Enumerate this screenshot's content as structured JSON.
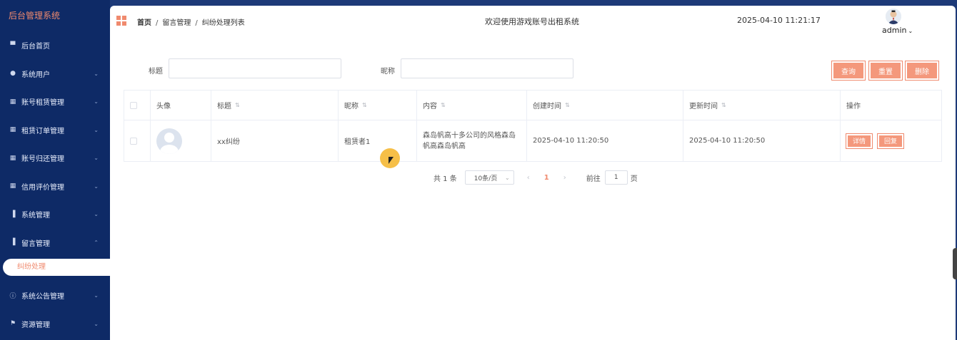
{
  "sidebar": {
    "brand": "后台管理系统",
    "items": [
      {
        "label": "后台首页",
        "icon": "monitor-icon"
      },
      {
        "label": "系统用户",
        "icon": "user-icon"
      },
      {
        "label": "账号租赁管理",
        "icon": "chart-icon"
      },
      {
        "label": "租赁订单管理",
        "icon": "chart-icon"
      },
      {
        "label": "账号归还管理",
        "icon": "chart-icon"
      },
      {
        "label": "信用评价管理",
        "icon": "chart-icon"
      },
      {
        "label": "系统管理",
        "icon": "bar-chart-icon"
      },
      {
        "label": "留言管理",
        "icon": "bar-chart-icon"
      }
    ],
    "active_sub": "纠纷处理",
    "lower_items": [
      {
        "label": "系统公告管理",
        "icon": "info-icon"
      },
      {
        "label": "资源管理",
        "icon": "flag-icon"
      }
    ]
  },
  "header": {
    "breadcrumb": [
      "首页",
      "留言管理",
      "纠纷处理列表"
    ],
    "welcome": "欢迎使用游戏账号出租系统",
    "datetime": "2025-04-10 11:21:17",
    "user": "admin"
  },
  "search": {
    "title_label": "标题",
    "title_value": "",
    "nickname_label": "昵称",
    "nickname_value": "",
    "query_btn": "查询",
    "reset_btn": "重置",
    "delete_btn": "删除"
  },
  "table": {
    "headers": [
      "头像",
      "标题",
      "昵称",
      "内容",
      "创建时间",
      "更新时间",
      "操作"
    ],
    "rows": [
      {
        "title": "xx纠纷",
        "nickname": "租赁者1",
        "content": "森岛帆高十多公司的风格森岛帆高森岛帆高",
        "created": "2025-04-10 11:20:50",
        "updated": "2025-04-10 11:20:50",
        "detail_btn": "详情",
        "reply_btn": "回复"
      }
    ]
  },
  "pager": {
    "total": "共 1 条",
    "page_size": "10条/页",
    "prev": "‹",
    "current": "1",
    "next": "›",
    "goto_label": "前往",
    "goto_value": "1",
    "page_unit": "页"
  },
  "colors": {
    "sidebar_bg": "#0e2a66",
    "accent": "#f08a6e",
    "button_bg": "#f4987c"
  }
}
